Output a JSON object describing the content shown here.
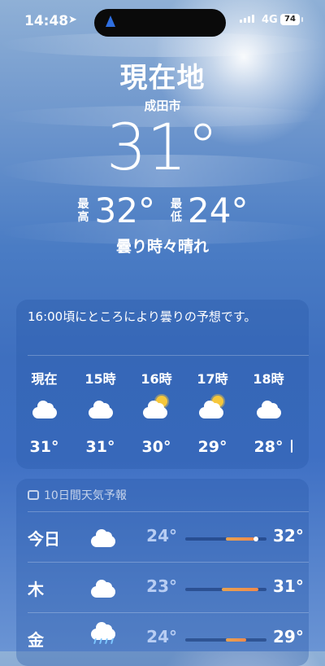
{
  "status_bar": {
    "time": "14:48",
    "network": "4G",
    "battery": "74"
  },
  "header": {
    "location": "現在地",
    "city": "成田市",
    "temperature": "31°",
    "high_label": "最高",
    "high": "32°",
    "low_label": "最低",
    "low": "24°",
    "condition": "曇り時々晴れ"
  },
  "hourly": {
    "summary": "16:00頃にところにより曇りの予想です。",
    "hours": [
      {
        "label": "現在",
        "icon": "cloud-icon",
        "temp": "31°"
      },
      {
        "label": "15時",
        "icon": "cloud-icon",
        "temp": "31°"
      },
      {
        "label": "16時",
        "icon": "partly-sunny-icon",
        "temp": "30°"
      },
      {
        "label": "17時",
        "icon": "partly-sunny-icon",
        "temp": "29°"
      },
      {
        "label": "18時",
        "icon": "cloud-icon",
        "temp": "28°"
      }
    ]
  },
  "daily": {
    "title": "10日間天気予報",
    "days": [
      {
        "day": "今日",
        "icon": "cloud-icon",
        "low": "24°",
        "high": "32°",
        "range_start": 0.5,
        "range_end": 0.85,
        "current": 0.87
      },
      {
        "day": "木",
        "icon": "cloud-icon",
        "low": "23°",
        "high": "31°",
        "range_start": 0.45,
        "range_end": 0.9
      },
      {
        "day": "金",
        "icon": "rain-icon",
        "low": "24°",
        "high": "29°",
        "range_start": 0.5,
        "range_end": 0.75
      }
    ]
  },
  "colors": {
    "sky_top": "#8fb0d6",
    "sky_mid": "#3e6fbf",
    "bar_warm": "#f08a4b",
    "low_temp": "#bed2f5",
    "sun": "#f6c73b"
  }
}
